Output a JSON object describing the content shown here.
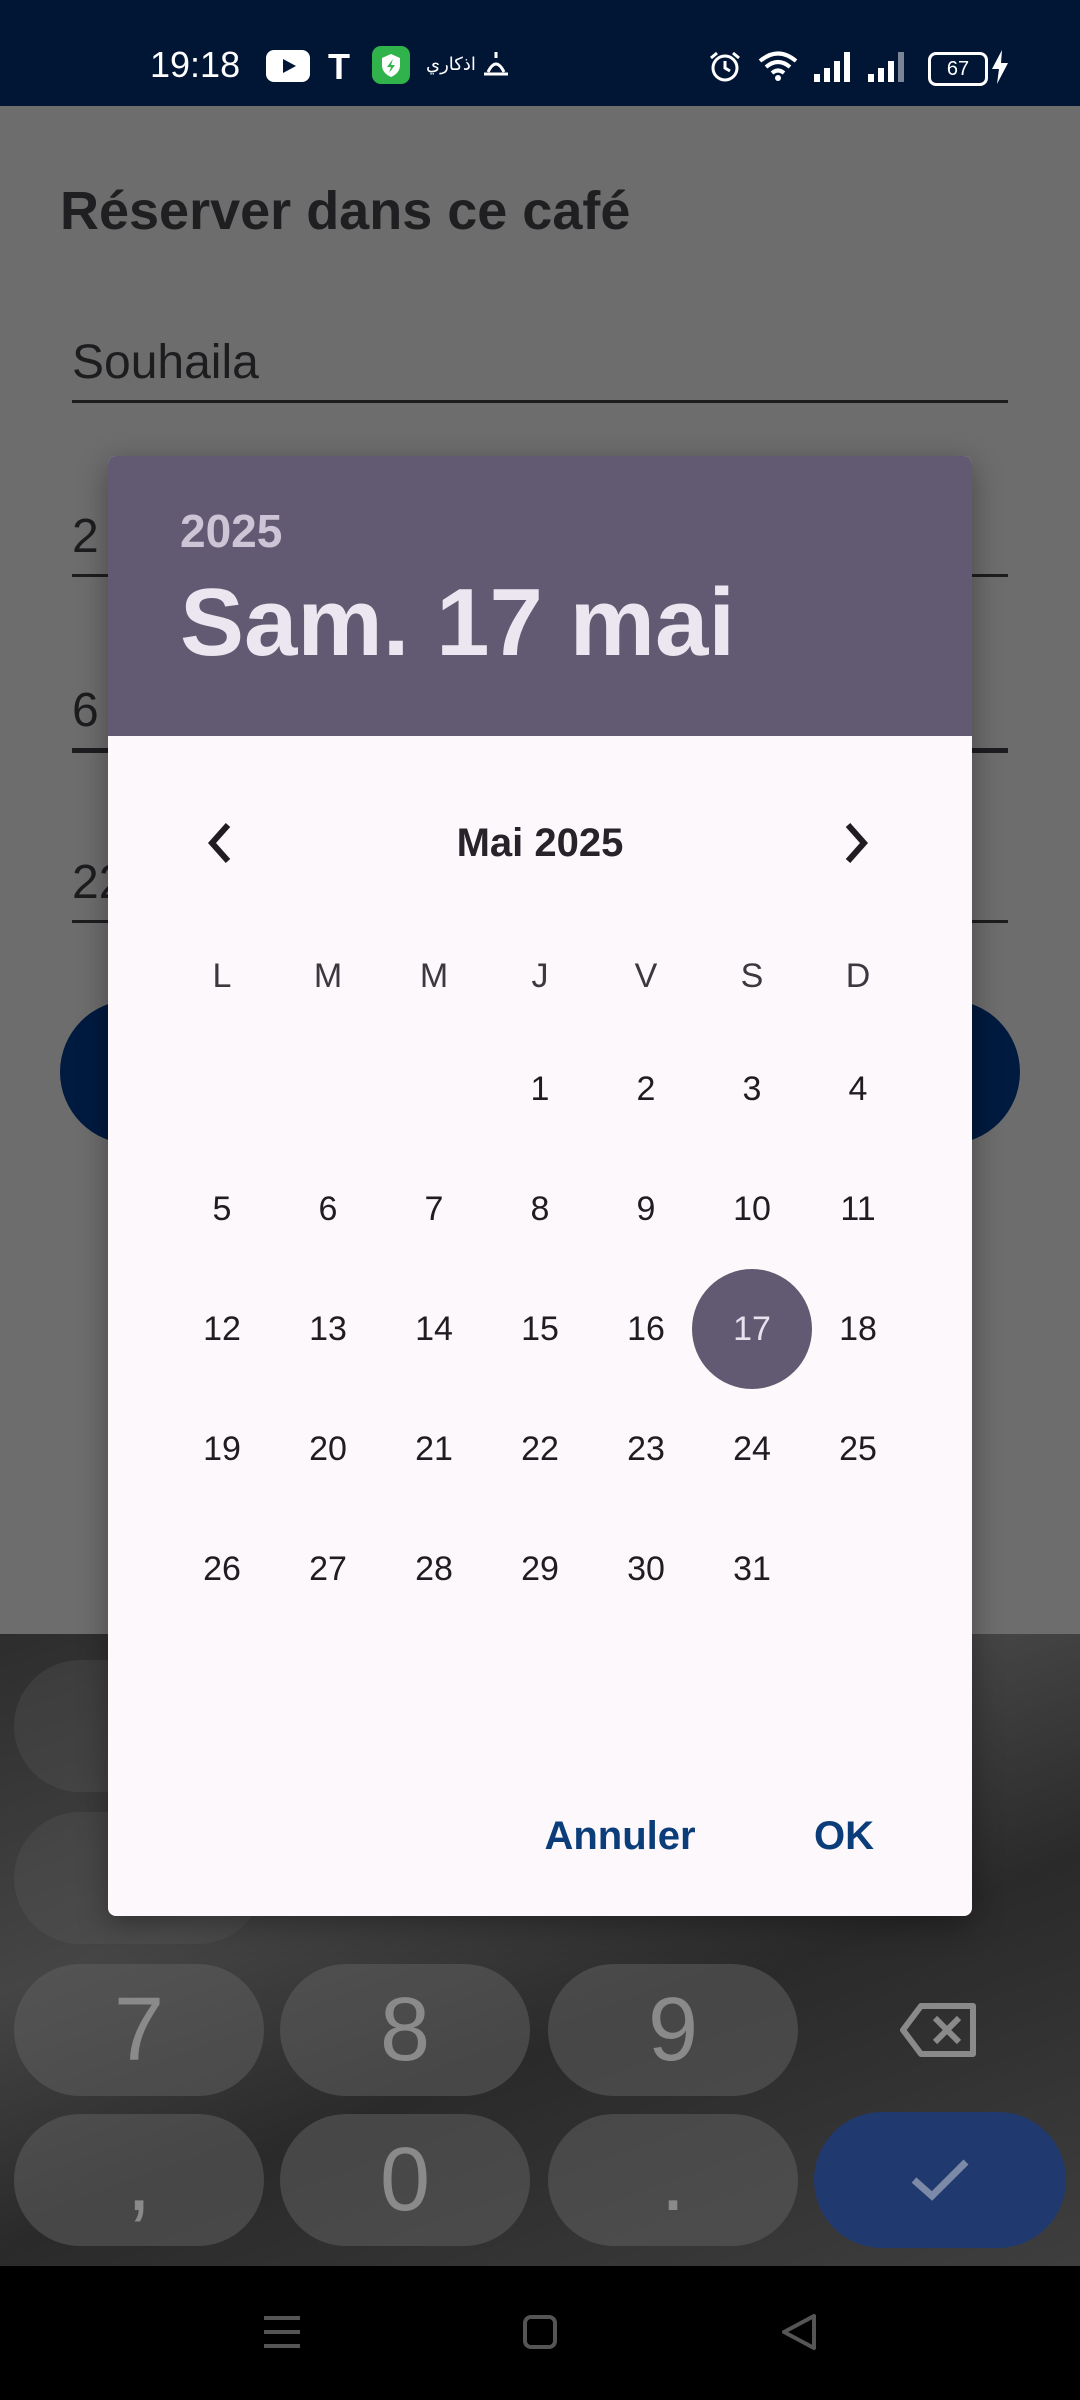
{
  "status_bar": {
    "time": "19:18",
    "battery": "67",
    "arabic_label": "اذكاري"
  },
  "app": {
    "title": "Réserver dans ce café",
    "fields": [
      {
        "value": "Souhaila"
      },
      {
        "value": "2"
      },
      {
        "value": "6"
      },
      {
        "value": "22"
      }
    ]
  },
  "dialog": {
    "year": "2025",
    "selected_date": "Sam. 17 mai",
    "month_label": "Mai 2025",
    "weekdays": [
      "L",
      "M",
      "M",
      "J",
      "V",
      "S",
      "D"
    ],
    "days": [
      "1",
      "2",
      "3",
      "4",
      "5",
      "6",
      "7",
      "8",
      "9",
      "10",
      "11",
      "12",
      "13",
      "14",
      "15",
      "16",
      "17",
      "18",
      "19",
      "20",
      "21",
      "22",
      "23",
      "24",
      "25",
      "26",
      "27",
      "28",
      "29",
      "30",
      "31"
    ],
    "first_weekday_index": 3,
    "selected_day": "17",
    "cancel_label": "Annuler",
    "ok_label": "OK",
    "accent_color": "#625a72"
  },
  "keyboard": {
    "keys": [
      "7",
      "8",
      "9",
      ",",
      "0",
      "."
    ]
  }
}
